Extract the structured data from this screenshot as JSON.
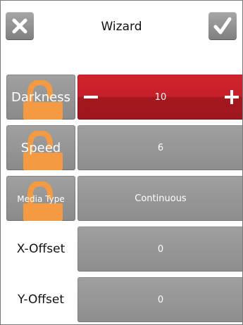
{
  "header": {
    "title": "Wizard",
    "cancel_icon": "close-icon",
    "confirm_icon": "check-icon"
  },
  "colors": {
    "active_row": "#c5202a",
    "button_gray": "#969696",
    "lock": "#f39a42"
  },
  "rows": [
    {
      "label": "Darkness",
      "value": "10",
      "locked": true,
      "active": true
    },
    {
      "label": "Speed",
      "value": "6",
      "locked": true,
      "active": false
    },
    {
      "label": "Media Type",
      "value": "Continuous",
      "locked": true,
      "active": false
    },
    {
      "label": "X-Offset",
      "value": "0",
      "locked": false,
      "active": false
    },
    {
      "label": "Y-Offset",
      "value": "0",
      "locked": false,
      "active": false
    }
  ],
  "icons": {
    "lock": "lock-icon",
    "minus": "minus-icon",
    "plus": "plus-icon"
  }
}
